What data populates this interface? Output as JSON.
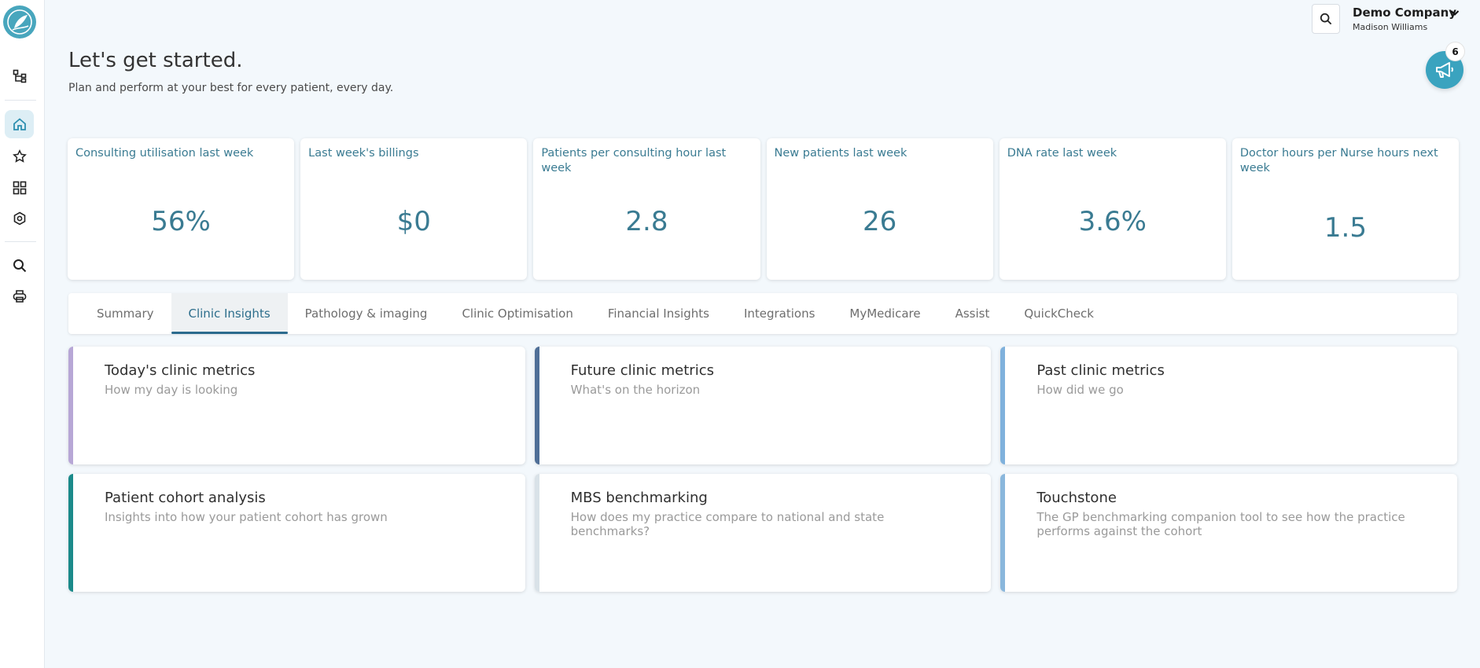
{
  "header": {
    "title": "Let's get started.",
    "subtitle": "Plan and perform at your best for every patient, every day."
  },
  "account": {
    "company": "Demo Company",
    "user": "Madison Williams"
  },
  "notifications": {
    "count": "6"
  },
  "colors": {
    "accent": "#3a7b92",
    "primary": "#3aa3bf",
    "tab_active": "#2b6a8e"
  },
  "sidebar": {
    "items": [
      {
        "icon": "hierarchy-icon"
      },
      {
        "icon": "home-icon",
        "active": true
      },
      {
        "icon": "star-icon"
      },
      {
        "icon": "dashboard-icon"
      },
      {
        "icon": "settings-icon"
      },
      {
        "icon": "search-icon"
      },
      {
        "icon": "print-icon"
      }
    ]
  },
  "metrics": [
    {
      "label": "Consulting utilisation last week",
      "value": "56%"
    },
    {
      "label": "Last week's billings",
      "value": "$0"
    },
    {
      "label": "Patients per consulting hour last week",
      "value": "2.8"
    },
    {
      "label": "New patients last week",
      "value": "26"
    },
    {
      "label": "DNA rate last week",
      "value": "3.6%"
    },
    {
      "label": "Doctor hours per Nurse hours next week",
      "value": "1.5"
    }
  ],
  "tabs": [
    {
      "label": "Summary"
    },
    {
      "label": "Clinic Insights",
      "active": true
    },
    {
      "label": "Pathology & imaging"
    },
    {
      "label": "Clinic Optimisation"
    },
    {
      "label": "Financial Insights"
    },
    {
      "label": "Integrations"
    },
    {
      "label": "MyMedicare"
    },
    {
      "label": "Assist"
    },
    {
      "label": "QuickCheck"
    }
  ],
  "insights": [
    {
      "title": "Today's clinic metrics",
      "description": "How my day is looking",
      "color": "#b7a7d6"
    },
    {
      "title": "Future clinic metrics",
      "description": "What's on the horizon",
      "color": "#4f6f97"
    },
    {
      "title": "Past clinic metrics",
      "description": "How did we go",
      "color": "#7fb1dc"
    },
    {
      "title": "Patient cohort analysis",
      "description": "Insights into how your patient cohort has grown",
      "color": "#1b8a8a"
    },
    {
      "title": "MBS benchmarking",
      "description": "How does my practice compare to national and state benchmarks?",
      "color": "#d9e2e8"
    },
    {
      "title": "Touchstone",
      "description": "The GP benchmarking companion tool to see how the practice performs against the cohort",
      "color": "#8ab7dc"
    }
  ]
}
